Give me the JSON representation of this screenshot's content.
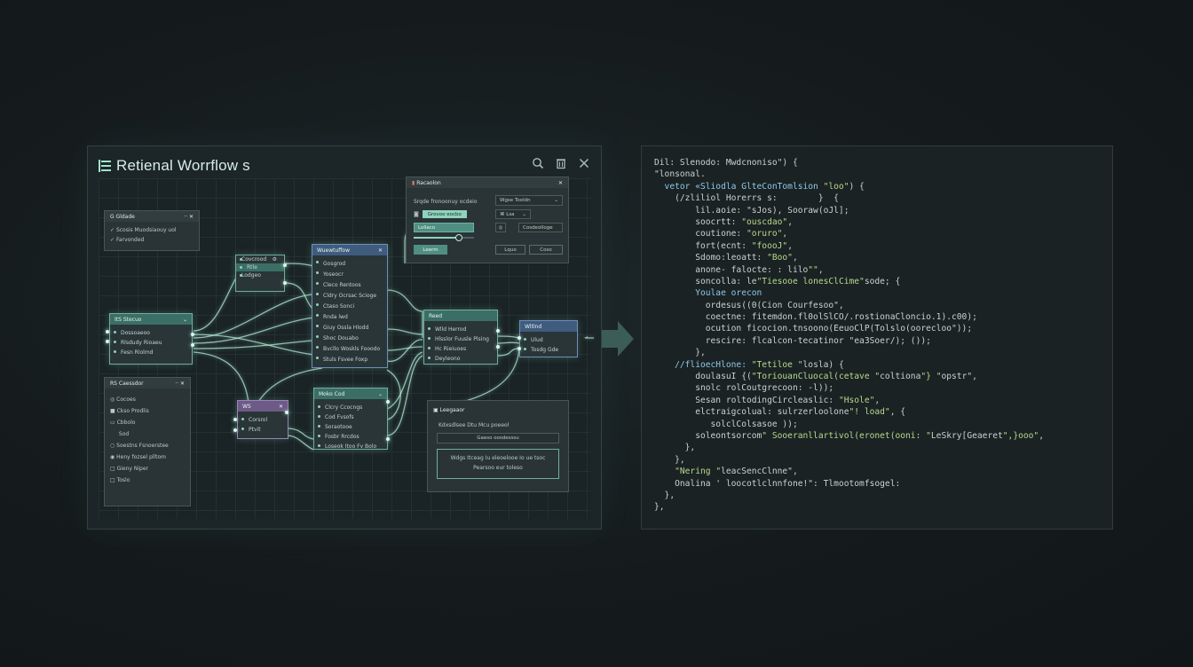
{
  "app": {
    "title": "Retienal Worrflow s",
    "toolbar_icons": [
      "search-icon",
      "trash-icon",
      "close-icon"
    ]
  },
  "nodes": {
    "globals": {
      "title": "G Gldade",
      "items": [
        "Scosis Muodsiaouy uol",
        "Farvonded"
      ]
    },
    "small_a": {
      "rows": [
        "Covcrood",
        "Rtle",
        "Lodgeo"
      ]
    },
    "main_blue": {
      "title": "Wuewtuffow",
      "rows": [
        "Gosgrod",
        "Yoseocr",
        "Cleco Rentoos",
        "Cldry Ocrsac Scioge",
        "Ctaso Sonci",
        "Rnda lwd",
        "Giuy Ossla Hlodd",
        "Shoc Douabo",
        "Bvcllo Woskls Fooodo",
        "Stuls Fsvee Foxp"
      ]
    },
    "left_teal": {
      "title": "ItS Stecuo",
      "rows": [
        "Dossoaeoo",
        "Rlsdudy Rioaeu",
        "Fesn Rlolmd"
      ]
    },
    "components": {
      "title": "RS Caessdor",
      "items": [
        "Cocoes",
        "Ckso Prodlis",
        "Cbbolo",
        "Sod",
        "Soestns Fsnoerstee",
        "Heny fozsel plltom",
        "Gieny Niper",
        "Toslo"
      ]
    },
    "purple": {
      "title": "WS",
      "rows": [
        "Corsrol",
        "Ptvit"
      ]
    },
    "mid_teal": {
      "title": "Moko Cod",
      "rows": [
        "Clcry Ccocngs",
        "Cod Fvsofs",
        "Soraotooe",
        "Fosbr Rrcdos",
        "Loseok Itoo Fv Bolo"
      ]
    },
    "right_teal": {
      "title": "Reed",
      "rows": [
        "Wlld Herrod",
        "Hlsslor Fuusle Plsing",
        "Hc Rieiuoes",
        "Deyleono"
      ]
    },
    "output_blue": {
      "title": "Wltlnd",
      "rows": [
        "Ulud",
        "Tosdg Gde"
      ]
    }
  },
  "properties_card": {
    "title": "Racaolon",
    "label_left": "Srqde fronoonuy ocdeio",
    "field_right": "Wgse Tooldn",
    "chip": "Grovoo eocbo",
    "field_mid": "Lollaco",
    "icon_field": "Lsa",
    "slider_value": 0.73,
    "btn_primary": "Leerm",
    "btn_secondary": "Lquo",
    "btn_tertiary": "Cosdeolloge"
  },
  "logs_card": {
    "title": "Leegaaor",
    "subtitle": "Kdxsdlsee Dtu Mcu poeeol",
    "field": "Gaeso oosdesssu",
    "box_line1": "Wdgs Itceag Iu eleoelooe Io ue tsoc",
    "box_line2": "Pearsoo eur toleso"
  },
  "code_lines": [
    "Dil: Slenodo: Mwdcnoniso\") {",
    "\"lonsonal.",
    "  vetor «Sliodla GlteConTomlsion \"loo\") {",
    "    (/zliliol Horerrs s:        }  {",
    "        lil.aoie: \"sJos), Sooraw(oJl];",
    "        soocrtt: \"ouscdao\",",
    "        coutione: \"oruro\",",
    "        fort(ecnt: \"foooJ\",",
    "        Sdomo:leoatt: \"Boo\",",
    "        anone- falocte: : lilo\"\",",
    "        soncolla: le\"Tiesooe lonesClCime\"sode; {",
    "        Youlae orecon",
    "          ordesus((0(Cion Courfesoo\",",
    "          coectne: fitemdon.fl0olSlCO/.rostionaCloncio.1).c00);",
    "          ocution ficocion.tnsoono(EeuoClP(Tolslo(oorecloo\"));",
    "          rescire: flcalcon-tecatinor \"ea3Soer/); ());",
    "        },",
    "    //flioecHlone: \"Tetiloe \"losla) {",
    "        doulasuI {(\"ToriouanCluocal(cetave \"coltiona\"} \"opstr\",",
    "        snolc rolCoutgrecoon: -l));",
    "        Sesan roltodingCircleaslic: \"Hsole\",",
    "        elctraigcolual: sulrzerloolone\"! load\", {",
    "           solclColsasoe ));",
    "        soleontsorcom\" Sooeranllartivol(eronet(ooni: \"LeSkry[Geaeret\",}ooo\",",
    "      },",
    "    },",
    "    \"Nering \"leacSencClnne\",",
    "    Onalina ' loocotlclnnfone!\": Tlmootomfsogel:",
    "  },",
    "},"
  ],
  "colors": {
    "accent_teal": "#3b6f66",
    "accent_blue": "#3f5b7e",
    "accent_purple": "#6d5a86",
    "wire_glow": "#b9efdc",
    "code_string": "#b7d98c",
    "code_keyword": "#8fc7e8"
  }
}
